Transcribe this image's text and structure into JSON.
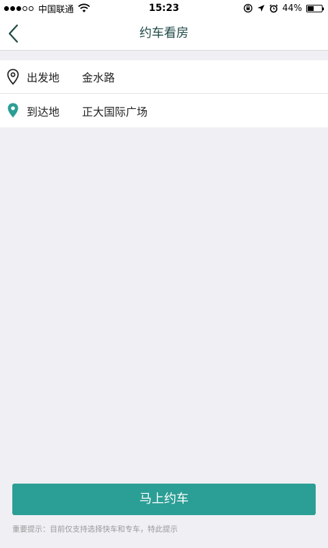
{
  "status_bar": {
    "signal_full": 3,
    "signal_total": 5,
    "carrier": "中国联通",
    "time": "15:23",
    "battery_percent": "44%",
    "battery_level": 0.44
  },
  "nav": {
    "title": "约车看房",
    "back_icon": "chevron-left-icon"
  },
  "route": {
    "origin": {
      "label": "出发地",
      "value": "金水路",
      "icon": "location-outline-icon"
    },
    "destination": {
      "label": "到达地",
      "value": "正大国际广场",
      "icon": "location-filled-icon"
    }
  },
  "action": {
    "button_label": "马上约车",
    "notice": "重要提示：目前仅支持选择快车和专车，特此提示"
  },
  "colors": {
    "accent": "#2b9e95",
    "title": "#1f4a46",
    "background": "#efeff4",
    "notice": "#9a9a9a"
  }
}
